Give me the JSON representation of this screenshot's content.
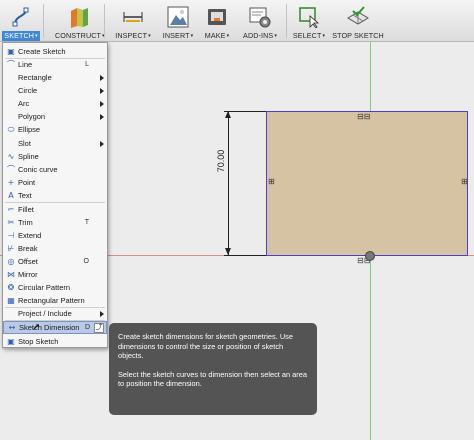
{
  "toolbar": {
    "groups": [
      {
        "label": "SKETCH",
        "active": true,
        "icon": "sketch-icon"
      },
      {
        "label": "CONSTRUCT",
        "icon": "construct-icon"
      },
      {
        "label": "INSPECT",
        "icon": "inspect-icon"
      },
      {
        "label": "INSERT",
        "icon": "insert-icon"
      },
      {
        "label": "MAKE",
        "icon": "make-icon"
      },
      {
        "label": "ADD-INS",
        "icon": "add-ins-icon"
      },
      {
        "label": "SELECT",
        "icon": "select-icon"
      },
      {
        "label": "STOP SKETCH",
        "icon": "stop-sketch-icon"
      }
    ],
    "dropdown_arrow": "▾"
  },
  "menu": {
    "items": [
      {
        "label": "Create Sketch",
        "icon": "create-sketch-icon",
        "glyph": "▣"
      },
      {
        "label": "Line",
        "icon": "line-icon",
        "glyph": "⌒",
        "shortcut": "L"
      },
      {
        "label": "Rectangle",
        "submenu": true
      },
      {
        "label": "Circle",
        "submenu": true
      },
      {
        "label": "Arc",
        "submenu": true
      },
      {
        "label": "Polygon",
        "submenu": true
      },
      {
        "label": "Ellipse",
        "icon": "ellipse-icon",
        "glyph": "⬭"
      },
      {
        "label": "Slot",
        "submenu": true
      },
      {
        "label": "Spline",
        "icon": "spline-icon",
        "glyph": "∿"
      },
      {
        "label": "Conic curve",
        "icon": "conic-curve-icon",
        "glyph": "⌒"
      },
      {
        "label": "Point",
        "icon": "point-icon",
        "glyph": "+"
      },
      {
        "label": "Text",
        "icon": "text-icon",
        "glyph": "A"
      },
      {
        "label": "Fillet",
        "icon": "fillet-icon",
        "glyph": "⌐"
      },
      {
        "label": "Trim",
        "icon": "trim-icon",
        "glyph": "✂",
        "shortcut": "T"
      },
      {
        "label": "Extend",
        "icon": "extend-icon",
        "glyph": "⊣"
      },
      {
        "label": "Break",
        "icon": "break-icon",
        "glyph": "⊬"
      },
      {
        "label": "Offset",
        "icon": "offset-icon",
        "glyph": "◎",
        "shortcut": "O"
      },
      {
        "label": "Mirror",
        "icon": "mirror-icon",
        "glyph": "⋈"
      },
      {
        "label": "Circular Pattern",
        "icon": "circular-pattern-icon",
        "glyph": "❂"
      },
      {
        "label": "Rectangular Pattern",
        "icon": "rectangular-pattern-icon",
        "glyph": "▦"
      },
      {
        "label": "Project / Include",
        "submenu": true
      },
      {
        "label": "Sketch Dimension",
        "icon": "sketch-dimension-icon",
        "glyph": "↔",
        "shortcut": "D",
        "highlighted": true
      },
      {
        "label": "Stop Sketch",
        "icon": "stop-sketch-menu-icon",
        "glyph": "▣"
      }
    ]
  },
  "canvas": {
    "dimension_value": "70.00"
  },
  "tooltip": {
    "para1": "Create sketch dimensions for sketch geometries. Use dimensions to control the size or position of sketch objects.",
    "para2": "Select the sketch curves to dimension then select an area to position the dimension."
  },
  "colors": {
    "sketch_fill": "#d5c3a3",
    "sketch_outline": "#4a3fd0",
    "axis_y": "#7bd17b",
    "axis_x": "#d98a8a",
    "active_tab": "#3f87d9",
    "menu_highlight": "#b9c9e6"
  }
}
